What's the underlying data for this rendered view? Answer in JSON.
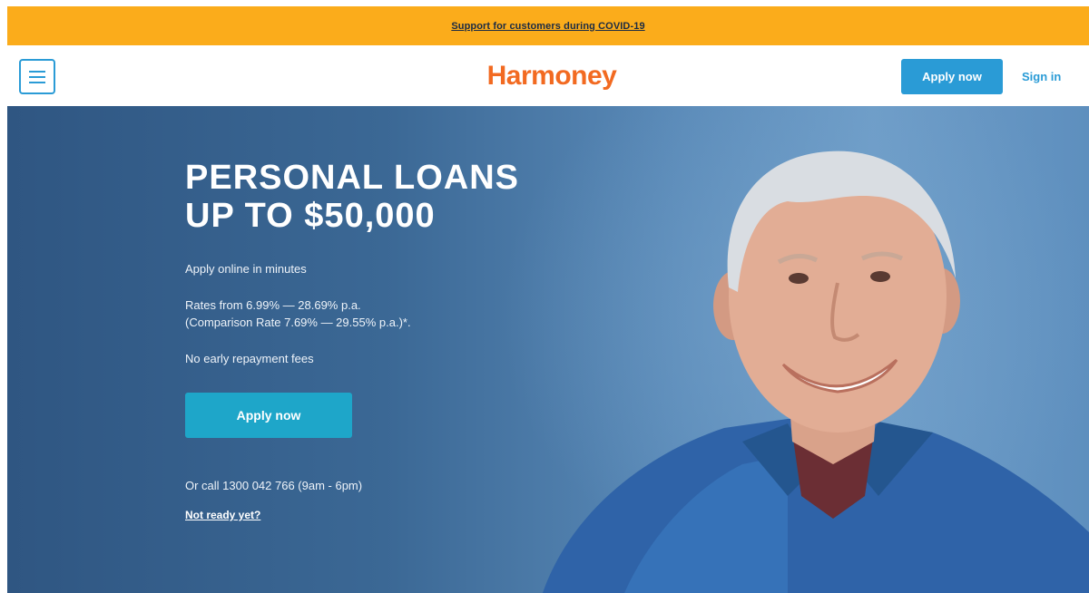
{
  "banner": {
    "link_text": "Support for customers during COVID-19"
  },
  "header": {
    "menu_icon": "hamburger-menu-icon",
    "logo_text": "Harmoney",
    "apply_label": "Apply now",
    "signin_label": "Sign in"
  },
  "hero": {
    "title_line1": "PERSONAL LOANS",
    "title_line2": "UP TO $50,000",
    "line_apply_online": "Apply online in minutes",
    "line_rates": "Rates from 6.99% — 28.69% p.a.",
    "line_comparison": "(Comparison Rate 7.69% — 29.55% p.a.)*.",
    "line_fees": "No early repayment fees",
    "apply_label": "Apply now",
    "call_text": "Or call 1300 042 766 (9am - 6pm)",
    "not_ready_label": "Not ready yet?"
  },
  "colors": {
    "banner": "#fbac1b",
    "brand_orange": "#f26a21",
    "accent_blue": "#2a9bd6",
    "hero_button": "#1ea6c9",
    "hero_bg": "#3b6895"
  }
}
